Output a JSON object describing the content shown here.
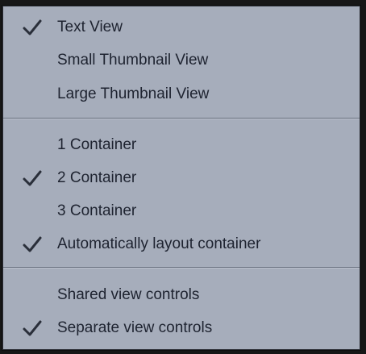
{
  "menu": {
    "items": [
      {
        "label": "Text View",
        "checked": true
      },
      {
        "label": "Small Thumbnail View",
        "checked": false
      },
      {
        "label": "Large Thumbnail View",
        "checked": false
      },
      {
        "label": "1 Container",
        "checked": false
      },
      {
        "label": "2 Container",
        "checked": true
      },
      {
        "label": "3 Container",
        "checked": false
      },
      {
        "label": "Automatically layout container",
        "checked": true
      },
      {
        "label": "Shared view controls",
        "checked": false
      },
      {
        "label": "Separate view controls",
        "checked": true
      }
    ],
    "colors": {
      "background": "#a6adbb",
      "text": "#1e2330",
      "check": "#2a2f3a",
      "separator": "#6a7180"
    },
    "check_icon": "checkmark-icon"
  }
}
